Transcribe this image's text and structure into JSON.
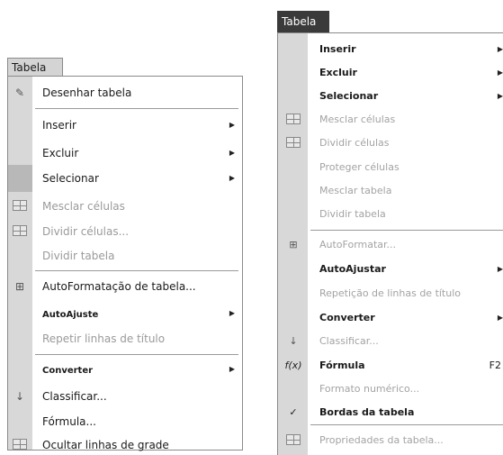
{
  "left_menu": {
    "title": "Tabela",
    "items": [
      {
        "label": "Desenhar tabela",
        "icon": "pencil-icon",
        "state": "enabled"
      },
      {
        "label": "Inserir",
        "submenu": true,
        "state": "enabled"
      },
      {
        "label": "Excluir",
        "submenu": true,
        "state": "enabled"
      },
      {
        "label": "Selecionar",
        "submenu": true,
        "state": "highlighted"
      },
      {
        "label": "Mesclar células",
        "icon": "merge-cells-icon",
        "state": "disabled"
      },
      {
        "label": "Dividir células...",
        "icon": "split-cells-icon",
        "state": "disabled"
      },
      {
        "label": "Dividir tabela",
        "state": "disabled"
      },
      {
        "label": "AutoFormatação de tabela...",
        "icon": "autoformat-icon",
        "state": "enabled"
      },
      {
        "label": "AutoAjuste",
        "submenu": true,
        "state": "enabled"
      },
      {
        "label": "Repetir linhas de título",
        "state": "disabled"
      },
      {
        "label": "Converter",
        "submenu": true,
        "state": "enabled"
      },
      {
        "label": "Classificar...",
        "icon": "sort-icon",
        "state": "enabled"
      },
      {
        "label": "Fórmula...",
        "state": "enabled"
      },
      {
        "label": "Ocultar linhas de grade",
        "icon": "gridlines-icon",
        "state": "enabled"
      }
    ]
  },
  "right_menu": {
    "title": "Tabela",
    "items": [
      {
        "label": "Inserir",
        "submenu": true,
        "state": "enabled"
      },
      {
        "label": "Excluir",
        "submenu": true,
        "state": "enabled"
      },
      {
        "label": "Selecionar",
        "submenu": true,
        "state": "enabled"
      },
      {
        "label": "Mesclar células",
        "icon": "merge-cells-icon",
        "state": "disabled"
      },
      {
        "label": "Dividir células",
        "icon": "split-cells-icon",
        "state": "disabled"
      },
      {
        "label": "Proteger células",
        "state": "disabled"
      },
      {
        "label": "Mesclar tabela",
        "state": "disabled"
      },
      {
        "label": "Dividir tabela",
        "state": "disabled"
      },
      {
        "label": "AutoFormatar...",
        "icon": "autoformat-icon",
        "state": "disabled"
      },
      {
        "label": "AutoAjustar",
        "submenu": true,
        "state": "enabled"
      },
      {
        "label": "Repetição de linhas de título",
        "state": "disabled"
      },
      {
        "label": "Converter",
        "submenu": true,
        "state": "enabled"
      },
      {
        "label": "Classificar...",
        "icon": "sort-icon",
        "state": "disabled"
      },
      {
        "label": "Fórmula",
        "icon": "formula-icon",
        "shortcut": "F2",
        "state": "enabled"
      },
      {
        "label": "Formato numérico...",
        "state": "disabled"
      },
      {
        "label": "Bordas da tabela",
        "icon": "check-icon",
        "state": "enabled"
      },
      {
        "label": "Propriedades da tabela...",
        "icon": "table-properties-icon",
        "state": "disabled"
      }
    ]
  }
}
